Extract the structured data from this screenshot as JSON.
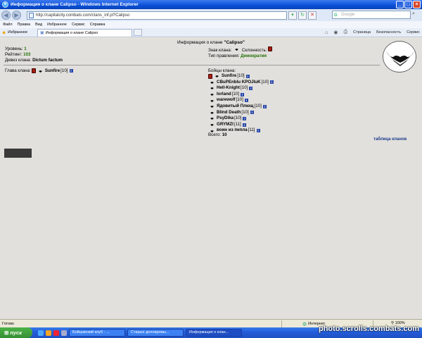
{
  "window": {
    "title": "Информация о клане Calipso - Windows Internet Explorer"
  },
  "address": {
    "url": "http://capitalcity.combats.com/clans_inf.pl?Calipso",
    "search_placeholder": "Google"
  },
  "menu": [
    "Файл",
    "Правка",
    "Вид",
    "Избранное",
    "Сервис",
    "Справка"
  ],
  "favbar": {
    "favorites_label": "Избранное",
    "tab_title": "Информация о клане Calipso"
  },
  "toolbar_right": {
    "page": "Страница",
    "safety": "Безопасность",
    "tools": "Сервис"
  },
  "clan": {
    "page_title_prefix": "Информация о клане",
    "name": "\"Calipso\"",
    "level_label": "Уровень:",
    "level": "1",
    "rating_label": "Рейтинг:",
    "rating": "103",
    "motto_label": "Девиз клана:",
    "motto": "Dictum factum",
    "sign_label": "Знак клана:",
    "alignment_label": "Склонность:",
    "government_label": "Тип правления:",
    "government": "Демократия",
    "head_label": "Глава клана:",
    "head_name": "Sunfire",
    "head_level": "[10]",
    "fighters_label": "Бойцы клана:",
    "fighters": [
      {
        "name": "Sunfire",
        "level": "[10]"
      },
      {
        "name": "CBuPEnblu KPOJIuK",
        "level": "[10]"
      },
      {
        "name": "Hell-Knight",
        "level": "[10]"
      },
      {
        "name": "Iorland",
        "level": "[10]"
      },
      {
        "name": "warewolf",
        "level": "[10]"
      },
      {
        "name": "Ядовитый Плющ",
        "level": "[10]"
      },
      {
        "name": "Blind Death",
        "level": "[10]"
      },
      {
        "name": "PsyDika",
        "level": "[10]"
      },
      {
        "name": "GRYMZI",
        "level": "[11]"
      },
      {
        "name": "воин из пепла",
        "level": "[11]"
      }
    ],
    "total_label": "Всего:",
    "total": "10",
    "clans_table_link": "таблица кланов"
  },
  "status": {
    "text": "Готово",
    "zone": "Интернет",
    "zoom": "100%"
  },
  "taskbar": {
    "start": "пуск",
    "tasks": [
      "Бойцовский клуб - ...",
      "Старые долларовы...",
      "Информация о клан..."
    ]
  },
  "watermark": "photo.scrolls.combats.com",
  "colors": {
    "green_value": "#207000",
    "link_blue": "#1a3a8a",
    "titlebar": "#0a4fd8"
  }
}
